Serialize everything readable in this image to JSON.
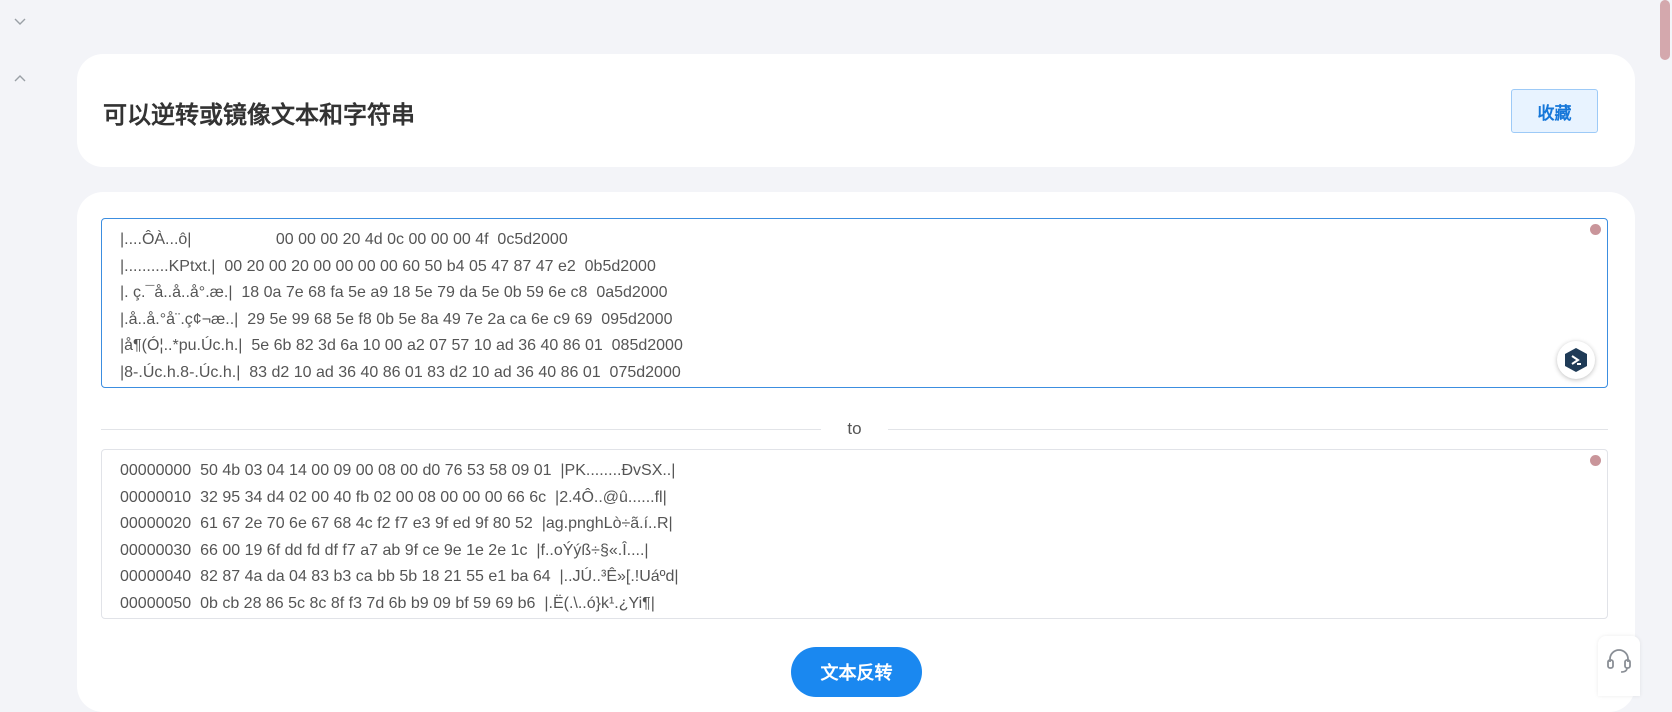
{
  "title": "可以逆转或镜像文本和字符串",
  "favorite_label": "收藏",
  "divider_label": "to",
  "action_label": "文本反转",
  "input_lines": [
    "|....ÔÀ...ô|                   00 00 00 20 4d 0c 00 00 00 4f  0c5d2000",
    "|..........KPtxt.|  00 20 00 20 00 00 00 00 60 50 b4 05 47 87 47 e2  0b5d2000",
    "|. ç.¯å..å..å°.æ.|  18 0a 7e 68 fa 5e a9 18 5e 79 da 5e 0b 59 6e c8  0a5d2000",
    "|.å..å.°å¨.ç¢¬æ..|  29 5e 99 68 5e f8 0b 5e 8a 49 7e 2a ca 6e c9 69  095d2000",
    "|å¶(Ó¦..*pu.Úc.h.|  5e 6b 82 3d 6a 10 00 a2 07 57 10 ad 36 40 86 01  085d2000",
    "|8-.Úc.h.8-.Úc.h.|  83 d2 10 ad 36 40 86 01 83 d2 10 ad 36 40 86 01  075d2000"
  ],
  "output_lines": [
    "00000000  50 4b 03 04 14 00 09 00 08 00 d0 76 53 58 09 01  |PK........ÐvSX..|",
    "00000010  32 95 34 d4 02 00 40 fb 02 00 08 00 00 00 66 6c  |2.4Ô..@û......fl|",
    "00000020  61 67 2e 70 6e 67 68 4c f2 f7 e3 9f ed 9f 80 52  |ag.pnghLò÷ã.í..R|",
    "00000030  66 00 19 6f dd fd df f7 a7 ab 9f ce 9e 1e 2e 1c  |f..oÝýß÷§«.Î....|",
    "00000040  82 87 4a da 04 83 b3 ca bb 5b 18 21 55 e1 ba 64  |..JÚ..³Ê»[.!Uáºd|",
    "00000050  0b cb 28 86 5c 8c 8f f3 7d 6b b9 09 bf 59 69 b6  |.Ë(.\\..ó}k¹.¿Yi¶|"
  ],
  "icons": {
    "collapse_down": "chevron-down-icon",
    "collapse_up": "chevron-up-icon",
    "assistant": "assistant-icon",
    "support": "headset-icon"
  },
  "colors": {
    "accent": "#1a88f0",
    "favorite_bg": "#e8f3ff",
    "page_bg": "#f3f4f8"
  }
}
